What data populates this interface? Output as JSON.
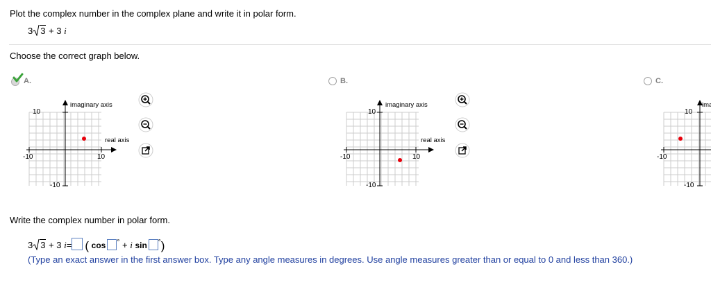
{
  "question": {
    "prompt": "Plot the complex number in the complex plane and write it in polar form.",
    "number": {
      "coef": "3",
      "radicand": "3",
      "rest": "+ 3",
      "imag": "i"
    }
  },
  "part1": {
    "prompt": "Choose the correct graph below.",
    "options": [
      {
        "label": "A.",
        "selected": true
      },
      {
        "label": "B.",
        "selected": false
      },
      {
        "label": "C.",
        "selected": false
      }
    ],
    "graph": {
      "imag_axis_label": "imaginary axis",
      "real_axis_label": "real axis",
      "tick_pos": "10",
      "tick_neg": "-10",
      "imag_axis_label_cut": "ima"
    }
  },
  "part2": {
    "prompt": "Write the complex number in polar form.",
    "eq_lhs_rest": "+ 3",
    "eq_imag": "i",
    "eq_equals": "=",
    "cos_label": "cos",
    "sin_label": "sin",
    "plus": "+",
    "degree": "°",
    "instructions": "(Type an exact answer in the first answer box. Type any angle measures in degrees. Use angle measures greater than or equal to 0 and less than 360.)"
  },
  "colors": {
    "accent": "#1f3f9f",
    "point": "#e8000b",
    "check": "#3aa33a"
  }
}
